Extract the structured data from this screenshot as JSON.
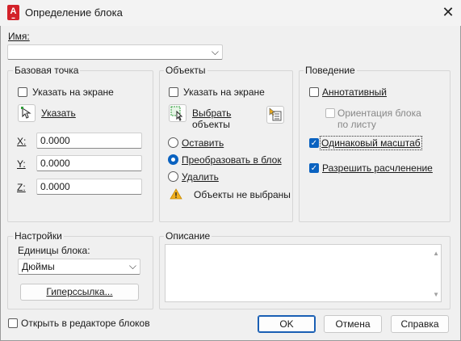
{
  "window": {
    "title": "Определение блока",
    "icon_text": "A"
  },
  "name": {
    "label": "Имя:",
    "value": ""
  },
  "base_point": {
    "group_label": "Базовая точка",
    "specify_on_screen": "Указать на экране",
    "pick_button": "Указать",
    "x_label": "X:",
    "x_value": "0.0000",
    "y_label": "Y:",
    "y_value": "0.0000",
    "z_label": "Z:",
    "z_value": "0.0000"
  },
  "objects": {
    "group_label": "Объекты",
    "specify_on_screen": "Указать на экране",
    "select_line1": "Выбрать",
    "select_line2": "объекты",
    "retain": "Оставить",
    "convert": "Преобразовать в блок",
    "delete": "Удалить",
    "warning": "Объекты не выбраны"
  },
  "behavior": {
    "group_label": "Поведение",
    "annotative": "Аннотативный",
    "orient_line1": "Ориентация блока",
    "orient_line2": "по листу",
    "uniform_scale": "Одинаковый масштаб",
    "allow_explode": "Разрешить расчленение"
  },
  "settings": {
    "group_label": "Настройки",
    "units_label": "Единицы блока:",
    "units_value": "Дюймы",
    "hyperlink_button": "Гиперссылка..."
  },
  "description": {
    "group_label": "Описание",
    "value": ""
  },
  "footer": {
    "open_in_editor": "Открыть в редакторе блоков",
    "ok": "OK",
    "cancel": "Отмена",
    "help": "Справка"
  }
}
